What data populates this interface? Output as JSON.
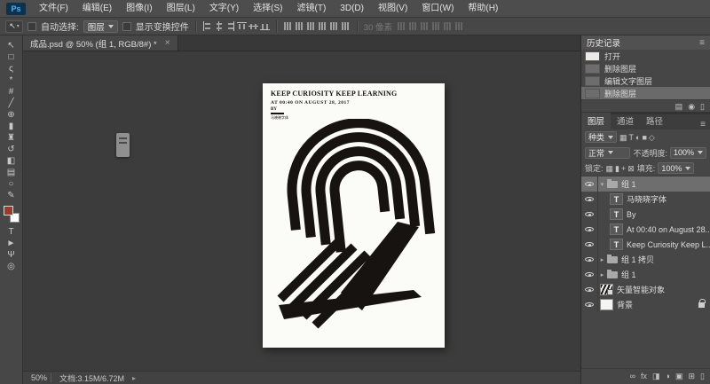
{
  "window": {
    "logo": "Ps"
  },
  "menu_bar": {
    "items": [
      {
        "label": "文件(F)"
      },
      {
        "label": "编辑(E)"
      },
      {
        "label": "图像(I)"
      },
      {
        "label": "图层(L)"
      },
      {
        "label": "文字(Y)"
      },
      {
        "label": "选择(S)"
      },
      {
        "label": "滤镜(T)"
      },
      {
        "label": "3D(D)"
      },
      {
        "label": "视图(V)"
      },
      {
        "label": "窗口(W)"
      },
      {
        "label": "帮助(H)"
      }
    ]
  },
  "options_bar": {
    "tool_glyph": "↖",
    "auto_select_label": "自动选择:",
    "auto_select_value": "图层",
    "show_transform_label": "显示变换控件",
    "px_field": "30 像素",
    "align_icons": [
      {
        "data_name": "align-left-icon"
      },
      {
        "data_name": "align-hcenter-icon"
      },
      {
        "data_name": "align-right-icon"
      },
      {
        "data_name": "align-top-icon"
      },
      {
        "data_name": "align-vcenter-icon"
      },
      {
        "data_name": "align-bottom-icon"
      }
    ],
    "distribute_icons": [
      {
        "data_name": "distribute-top-icon"
      },
      {
        "data_name": "distribute-vcenter-icon"
      },
      {
        "data_name": "distribute-bottom-icon"
      },
      {
        "data_name": "distribute-left-icon"
      },
      {
        "data_name": "distribute-hcenter-icon"
      },
      {
        "data_name": "distribute-right-icon"
      }
    ],
    "extra_icons": [
      {
        "data_name": "auto-align-icon"
      },
      {
        "data_name": "auto-align-icon"
      },
      {
        "data_name": "auto-align-icon"
      },
      {
        "data_name": "auto-align-icon"
      },
      {
        "data_name": "auto-align-icon"
      },
      {
        "data_name": "auto-align-icon"
      }
    ]
  },
  "tab": {
    "title": "成品.psd @ 50% (组 1, RGB/8#) *",
    "close_glyph": "×"
  },
  "tools_top": [
    {
      "data_name": "move-tool",
      "glyph": "↖"
    },
    {
      "data_name": "rectangular-marquee-tool",
      "glyph": "□"
    },
    {
      "data_name": "lasso-tool",
      "glyph": "ς"
    },
    {
      "data_name": "magic-wand-tool",
      "glyph": "*"
    },
    {
      "data_name": "crop-tool",
      "glyph": "#"
    },
    {
      "data_name": "eyedropper-tool",
      "glyph": "╱"
    },
    {
      "data_name": "healing-brush-tool",
      "glyph": "⊕"
    },
    {
      "data_name": "brush-tool",
      "glyph": "▮"
    },
    {
      "data_name": "clone-stamp-tool",
      "glyph": "♜"
    },
    {
      "data_name": "history-brush-tool",
      "glyph": "↺"
    },
    {
      "data_name": "eraser-tool",
      "glyph": "◧"
    },
    {
      "data_name": "gradient-tool",
      "glyph": "▤"
    },
    {
      "data_name": "blur-tool",
      "glyph": "○"
    },
    {
      "data_name": "pen-tool",
      "glyph": "✎"
    }
  ],
  "tools_bottom": [
    {
      "data_name": "type-tool",
      "glyph": "T"
    },
    {
      "data_name": "path-selection-tool",
      "glyph": "►"
    },
    {
      "data_name": "hand-tool",
      "glyph": "Ψ"
    },
    {
      "data_name": "zoom-tool",
      "glyph": "◎"
    }
  ],
  "colors": {
    "foreground": "#9c3a2b",
    "background": "#ffffff"
  },
  "poster": {
    "title": "KEEP CURIOSITY KEEP LEARNING",
    "subtitle": "AT 00:40 ON AUGUST 28, 2017",
    "byline": "BY",
    "credit": "马晓晓字体"
  },
  "history_panel": {
    "title": "历史记录",
    "menu_glyph": "≡",
    "items": [
      {
        "label": "打开"
      },
      {
        "label": "删除图层"
      },
      {
        "label": "编辑文字图层"
      },
      {
        "label": "删除图层",
        "selected": true
      }
    ],
    "footer_icons": [
      {
        "data_name": "new-document-from-state-icon",
        "glyph": "▤"
      },
      {
        "data_name": "new-snapshot-icon",
        "glyph": "◉"
      },
      {
        "data_name": "delete-state-icon",
        "glyph": "▯"
      }
    ]
  },
  "layers_panel": {
    "tabs": [
      {
        "label": "图层",
        "active": true
      },
      {
        "label": "通道"
      },
      {
        "label": "路径"
      }
    ],
    "menu_glyph": "≡",
    "kind_label": "种类",
    "filter_icons": [
      {
        "data_name": "filter-pixel-layers-icon",
        "glyph": "▦"
      },
      {
        "data_name": "filter-text-layers-icon",
        "glyph": "T"
      },
      {
        "data_name": "filter-adjustment-layers-icon",
        "glyph": "◐"
      },
      {
        "data_name": "filter-shape-layers-icon",
        "glyph": "■"
      },
      {
        "data_name": "filter-smart-objects-icon",
        "glyph": "◇"
      }
    ],
    "blend_mode": "正常",
    "opacity_label": "不透明度:",
    "opacity_value": "100%",
    "lock_label": "锁定:",
    "lock_icons": [
      {
        "data_name": "lock-transparency-icon",
        "glyph": "▦"
      },
      {
        "data_name": "lock-pixels-icon",
        "glyph": "▮"
      },
      {
        "data_name": "lock-position-icon",
        "glyph": "+"
      },
      {
        "data_name": "lock-all-icon",
        "glyph": "⊠"
      }
    ],
    "fill_label": "填充:",
    "fill_value": "100%",
    "layers": [
      {
        "name": "组 1",
        "type": "group",
        "selected": true,
        "expanded": true
      },
      {
        "name": "马晓晓字体",
        "type": "text"
      },
      {
        "name": "By",
        "type": "text"
      },
      {
        "name": "At 00:40 on August 28...",
        "type": "text"
      },
      {
        "name": "Keep Curiosity Keep L...",
        "type": "text"
      },
      {
        "name": "组 1 拷贝",
        "type": "group"
      },
      {
        "name": "组 1",
        "type": "group"
      },
      {
        "name": "矢量智能对象",
        "type": "smart"
      },
      {
        "name": "背景",
        "type": "background",
        "locked": true
      }
    ],
    "footer_icons": [
      {
        "data_name": "link-layers-icon",
        "glyph": "∞"
      },
      {
        "data_name": "layer-effects-icon",
        "glyph": "fx"
      },
      {
        "data_name": "add-layer-mask-icon",
        "glyph": "◨"
      },
      {
        "data_name": "adjustment-layer-icon",
        "glyph": "◑"
      },
      {
        "data_name": "new-group-icon",
        "glyph": "▣"
      },
      {
        "data_name": "new-layer-icon",
        "glyph": "⊞"
      },
      {
        "data_name": "delete-layer-icon",
        "glyph": "▯"
      }
    ]
  },
  "status_bar": {
    "zoom": "50%",
    "doc_label": "文档:3.15M/6.72M",
    "arrow_glyph": "▸"
  }
}
